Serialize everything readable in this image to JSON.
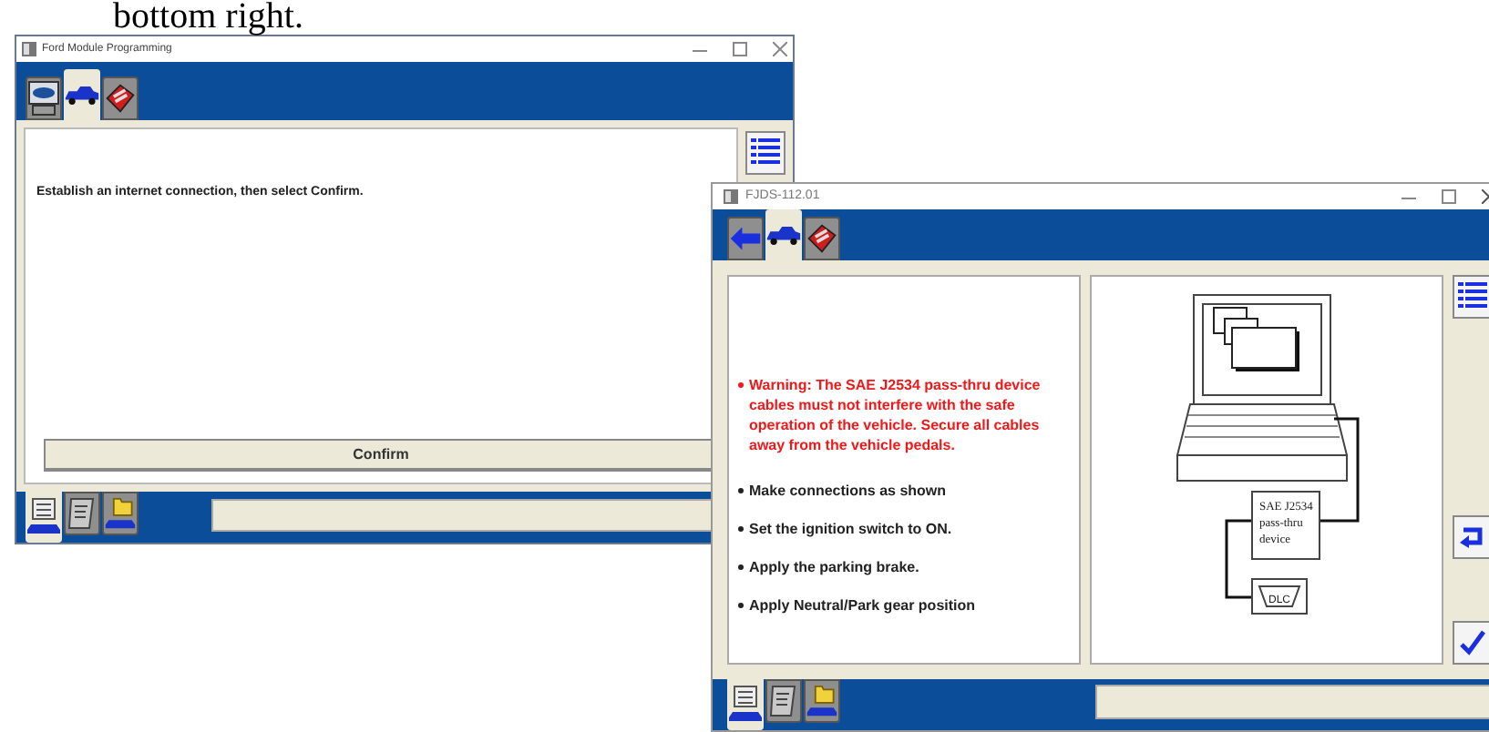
{
  "caption": "bottom right.",
  "program_window": {
    "title": "Ford Module Programming",
    "top_tabs": [
      {
        "kind": "logo",
        "selected": false
      },
      {
        "kind": "car",
        "selected": true
      },
      {
        "kind": "tools",
        "selected": false
      }
    ],
    "message": "Establish an internet connection, then select Confirm.",
    "confirm_button": "Confirm",
    "bottom_tabs": [
      {
        "kind": "report",
        "selected": true
      },
      {
        "kind": "scroll",
        "selected": false
      },
      {
        "kind": "folder",
        "selected": false
      }
    ]
  },
  "fjds_window": {
    "title": "FJDS-112.01",
    "top_tabs": [
      {
        "kind": "back",
        "selected": false
      },
      {
        "kind": "car",
        "selected": true
      },
      {
        "kind": "tools",
        "selected": false
      }
    ],
    "instructions": [
      {
        "kind": "warning",
        "text": "Warning: The SAE J2534 pass-thru device cables must not interfere with the safe operation of the vehicle. Secure all cables away from the vehicle pedals."
      },
      {
        "kind": "step",
        "text": "Make connections as shown"
      },
      {
        "kind": "step",
        "text": "Set the ignition switch to ON."
      },
      {
        "kind": "step",
        "text": "Apply the parking brake."
      },
      {
        "kind": "step",
        "text": "Apply Neutral/Park gear position"
      }
    ],
    "diagram": {
      "device_label": [
        "SAE J2534",
        "pass-thru",
        "device"
      ],
      "connector_label": "DLC"
    },
    "bottom_tabs": [
      {
        "kind": "report",
        "selected": true
      },
      {
        "kind": "scroll",
        "selected": false
      },
      {
        "kind": "folder",
        "selected": false
      }
    ]
  }
}
